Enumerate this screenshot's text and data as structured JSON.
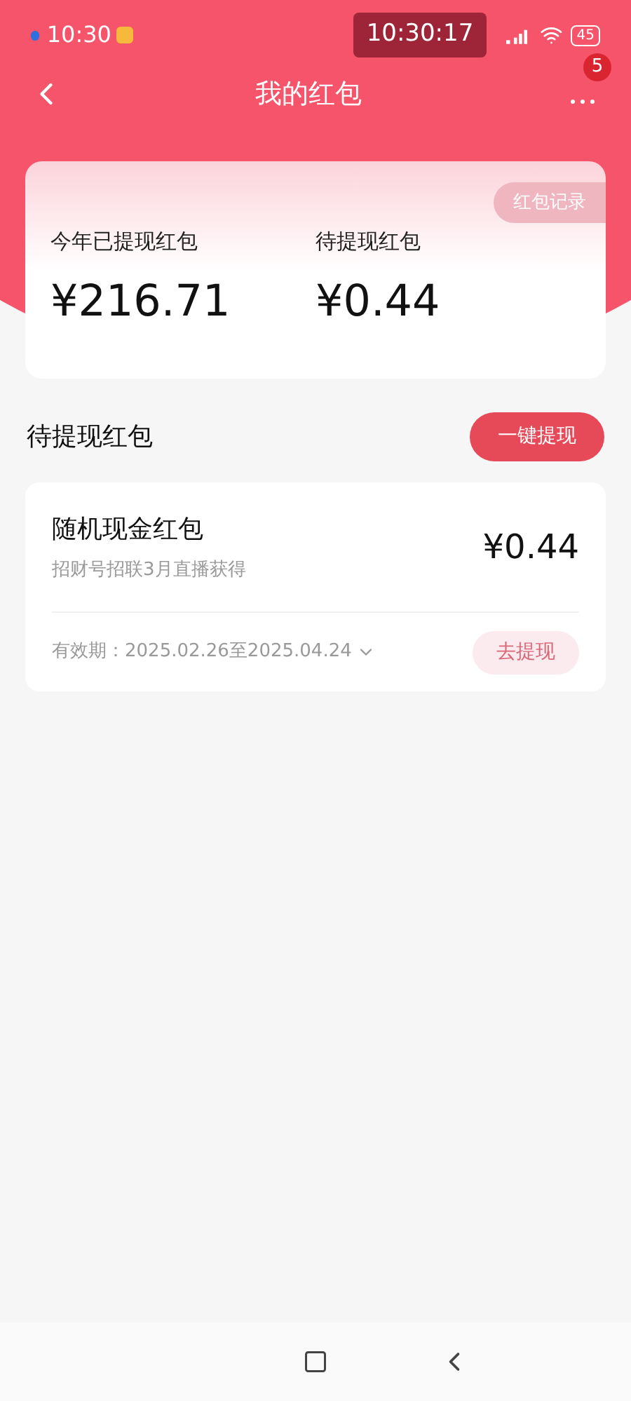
{
  "status_bar": {
    "time": "10:30",
    "clock": "10:30:17",
    "battery": "45"
  },
  "nav": {
    "title": "我的红包",
    "badge": "5"
  },
  "summary": {
    "record_button": "红包记录",
    "stats": [
      {
        "label": "今年已提现红包",
        "amount": "¥216.71"
      },
      {
        "label": "待提现红包",
        "amount": "¥0.44"
      }
    ]
  },
  "section": {
    "title": "待提现红包",
    "button": "一键提现"
  },
  "packets": [
    {
      "title": "随机现金红包",
      "source": "招财号招联3月直播获得",
      "amount": "¥0.44",
      "validity": "有效期：2025.02.26至2025.04.24",
      "action": "去提现"
    }
  ]
}
